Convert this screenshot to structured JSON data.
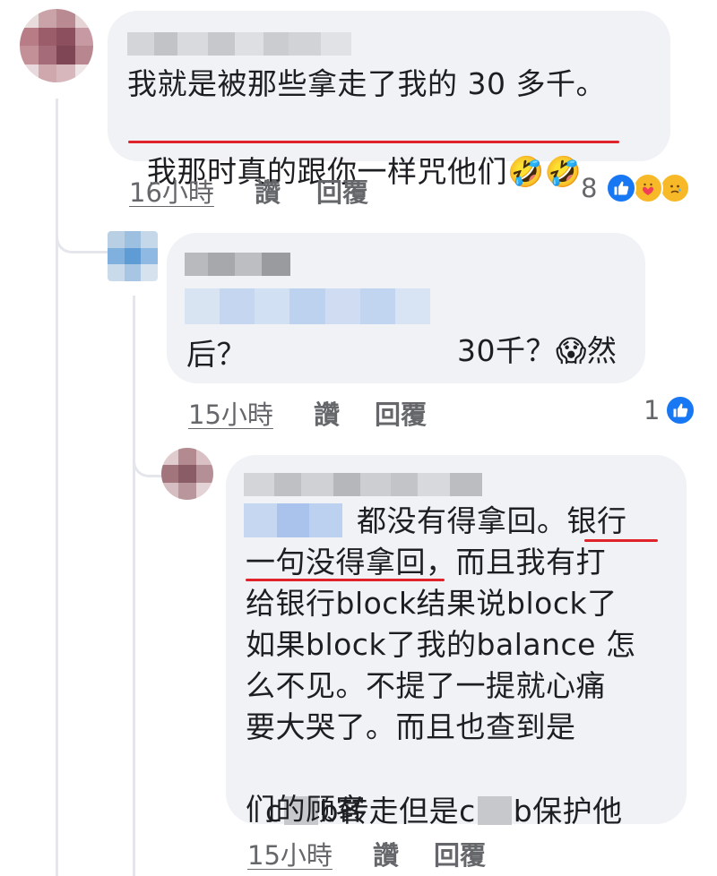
{
  "comment1": {
    "line1": "我就是被那些拿走了我的 30 多千。",
    "line2": "我那时真的跟你一样咒他们",
    "emoji": "🤣🤣",
    "time": "16小時",
    "like": "讚",
    "reply": "回覆",
    "reaction_count": "8",
    "reactions": [
      "like-icon",
      "care-icon",
      "sad-icon"
    ]
  },
  "comment2": {
    "line1_suffix": "30千？",
    "emoji": "😱",
    "line1_end": "然",
    "line2": "后？",
    "time": "15小時",
    "like": "讚",
    "reply": "回覆",
    "reaction_count": "1",
    "reactions": [
      "like-icon"
    ]
  },
  "comment3": {
    "line1": "都没有得拿回。银行",
    "line2": "一句没得拿回，而且我有打",
    "line3": "给银行block结果说block了",
    "line4": "如果block了我的balance 怎",
    "line5": "么不见。不提了一提就心痛",
    "line6": "要大哭了。而且也查到是",
    "line7_a": "c",
    "line7_b": "b转走但是c",
    "line7_c": "b保护他",
    "line8": "们的顾客",
    "time": "15小時",
    "like": "讚",
    "reply": "回覆"
  },
  "colors": {
    "bubble": "#f0f2f5",
    "meta": "#65676b",
    "underline": "#e0222a",
    "like_blue": "#1877f2"
  }
}
